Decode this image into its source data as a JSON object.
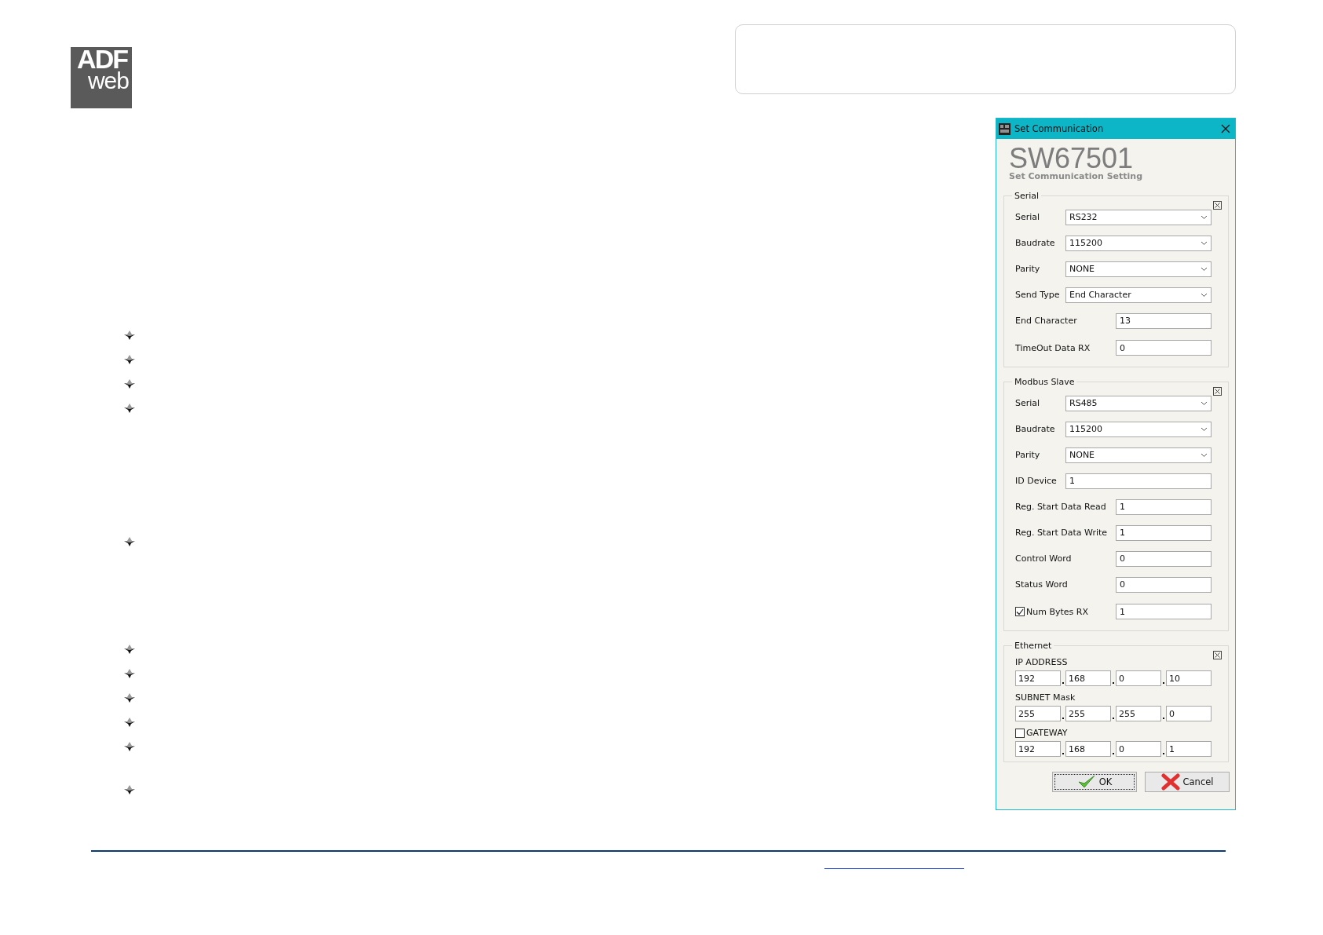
{
  "logo": {
    "line_1": "ADF",
    "line_2": "web"
  },
  "dialog": {
    "title": "Set Communication",
    "product": "SW67501",
    "subtitle": "Set Communication Setting",
    "sections": [
      {
        "legend": "Serial",
        "rows": [
          {
            "kind": "dropdown",
            "label": "Serial",
            "value": "RS232"
          },
          {
            "kind": "dropdown",
            "label": "Baudrate",
            "value": "115200"
          },
          {
            "kind": "dropdown",
            "label": "Parity",
            "value": "NONE"
          },
          {
            "kind": "dropdown",
            "label": "Send Type",
            "value": "End Character"
          },
          {
            "kind": "input",
            "label": "End Character",
            "value": "13"
          },
          {
            "kind": "input",
            "label": "TimeOut Data RX",
            "value": "0"
          }
        ]
      },
      {
        "legend": "Modbus Slave",
        "rows": [
          {
            "kind": "dropdown",
            "label": "Serial",
            "value": "RS485"
          },
          {
            "kind": "dropdown",
            "label": "Baudrate",
            "value": "115200"
          },
          {
            "kind": "dropdown",
            "label": "Parity",
            "value": "NONE"
          },
          {
            "kind": "input-wide",
            "label": "ID Device",
            "value": "1"
          },
          {
            "kind": "input",
            "label": "Reg. Start Data Read",
            "value": "1"
          },
          {
            "kind": "input",
            "label": "Reg. Start Data Write",
            "value": "1"
          },
          {
            "kind": "input",
            "label": "Control Word",
            "value": "0"
          },
          {
            "kind": "input",
            "label": "Status Word",
            "value": "0"
          },
          {
            "kind": "checkbox-input",
            "label": "Num Bytes RX",
            "checked": true,
            "value": "1"
          }
        ]
      }
    ],
    "ethernet": {
      "legend": "Ethernet",
      "groups": [
        {
          "label": "IP ADDRESS",
          "octets": [
            "192",
            "168",
            "0",
            "10"
          ]
        },
        {
          "label": "SUBNET Mask",
          "octets": [
            "255",
            "255",
            "255",
            "0"
          ]
        },
        {
          "label": "GATEWAY",
          "checked": false,
          "octets": [
            "192",
            "168",
            "0",
            "1"
          ]
        }
      ]
    },
    "buttons": [
      {
        "kind": "ok",
        "label": "OK",
        "focused": true
      },
      {
        "kind": "cancel",
        "label": "Cancel",
        "focused": false
      }
    ]
  }
}
